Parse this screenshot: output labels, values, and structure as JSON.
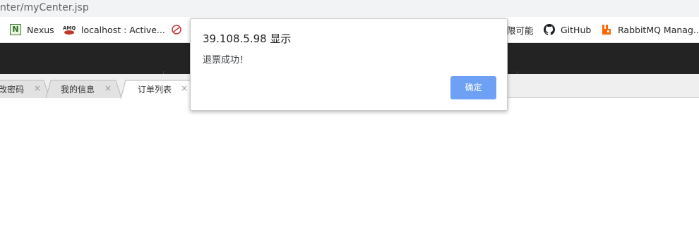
{
  "browser": {
    "address_text": "nter/myCenter.jsp"
  },
  "bookmarks": {
    "items": [
      {
        "label": "Nexus",
        "icon": "nexus-icon"
      },
      {
        "label": "localhost : Active...",
        "icon": "activemq-icon"
      },
      {
        "label": "",
        "icon": "red-bookmark-icon"
      },
      {
        "label": "限可能",
        "icon": ""
      },
      {
        "label": "GitHub",
        "icon": "github-icon"
      },
      {
        "label": "RabbitMQ Manag...",
        "icon": "rabbitmq-icon"
      }
    ]
  },
  "tabs": [
    {
      "label": "改密码",
      "close": "×"
    },
    {
      "label": "我的信息",
      "close": "×"
    },
    {
      "label": "订单列表",
      "close": "×"
    }
  ],
  "dialog": {
    "title": "39.108.5.98 显示",
    "message": "退票成功！",
    "ok_label": "确定"
  },
  "colors": {
    "header_dark": "#232323",
    "dialog_button": "#6ea0f5"
  }
}
